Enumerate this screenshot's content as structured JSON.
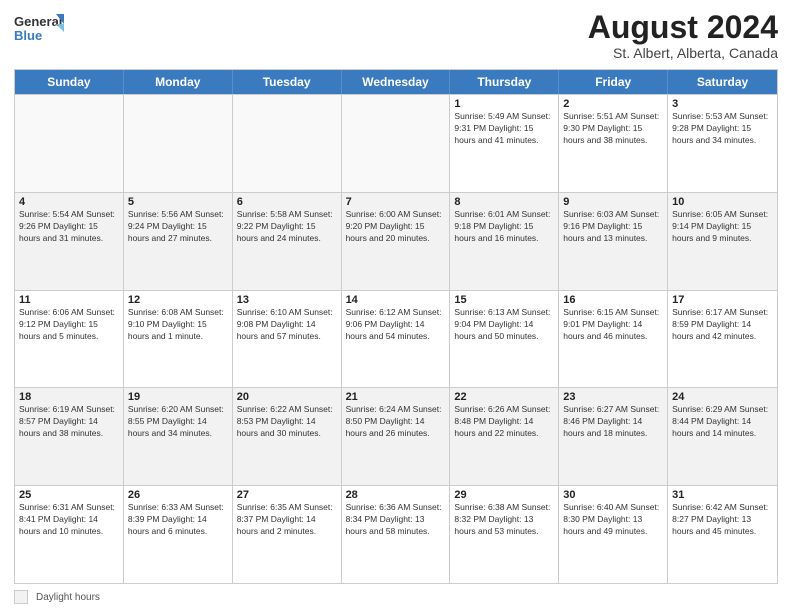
{
  "header": {
    "logo_line1": "General",
    "logo_line2": "Blue",
    "month_title": "August 2024",
    "subtitle": "St. Albert, Alberta, Canada"
  },
  "calendar": {
    "days_of_week": [
      "Sunday",
      "Monday",
      "Tuesday",
      "Wednesday",
      "Thursday",
      "Friday",
      "Saturday"
    ],
    "rows": [
      [
        {
          "day": "",
          "info": "",
          "empty": true
        },
        {
          "day": "",
          "info": "",
          "empty": true
        },
        {
          "day": "",
          "info": "",
          "empty": true
        },
        {
          "day": "",
          "info": "",
          "empty": true
        },
        {
          "day": "1",
          "info": "Sunrise: 5:49 AM\nSunset: 9:31 PM\nDaylight: 15 hours\nand 41 minutes."
        },
        {
          "day": "2",
          "info": "Sunrise: 5:51 AM\nSunset: 9:30 PM\nDaylight: 15 hours\nand 38 minutes."
        },
        {
          "day": "3",
          "info": "Sunrise: 5:53 AM\nSunset: 9:28 PM\nDaylight: 15 hours\nand 34 minutes."
        }
      ],
      [
        {
          "day": "4",
          "info": "Sunrise: 5:54 AM\nSunset: 9:26 PM\nDaylight: 15 hours\nand 31 minutes."
        },
        {
          "day": "5",
          "info": "Sunrise: 5:56 AM\nSunset: 9:24 PM\nDaylight: 15 hours\nand 27 minutes."
        },
        {
          "day": "6",
          "info": "Sunrise: 5:58 AM\nSunset: 9:22 PM\nDaylight: 15 hours\nand 24 minutes."
        },
        {
          "day": "7",
          "info": "Sunrise: 6:00 AM\nSunset: 9:20 PM\nDaylight: 15 hours\nand 20 minutes."
        },
        {
          "day": "8",
          "info": "Sunrise: 6:01 AM\nSunset: 9:18 PM\nDaylight: 15 hours\nand 16 minutes."
        },
        {
          "day": "9",
          "info": "Sunrise: 6:03 AM\nSunset: 9:16 PM\nDaylight: 15 hours\nand 13 minutes."
        },
        {
          "day": "10",
          "info": "Sunrise: 6:05 AM\nSunset: 9:14 PM\nDaylight: 15 hours\nand 9 minutes."
        }
      ],
      [
        {
          "day": "11",
          "info": "Sunrise: 6:06 AM\nSunset: 9:12 PM\nDaylight: 15 hours\nand 5 minutes."
        },
        {
          "day": "12",
          "info": "Sunrise: 6:08 AM\nSunset: 9:10 PM\nDaylight: 15 hours\nand 1 minute."
        },
        {
          "day": "13",
          "info": "Sunrise: 6:10 AM\nSunset: 9:08 PM\nDaylight: 14 hours\nand 57 minutes."
        },
        {
          "day": "14",
          "info": "Sunrise: 6:12 AM\nSunset: 9:06 PM\nDaylight: 14 hours\nand 54 minutes."
        },
        {
          "day": "15",
          "info": "Sunrise: 6:13 AM\nSunset: 9:04 PM\nDaylight: 14 hours\nand 50 minutes."
        },
        {
          "day": "16",
          "info": "Sunrise: 6:15 AM\nSunset: 9:01 PM\nDaylight: 14 hours\nand 46 minutes."
        },
        {
          "day": "17",
          "info": "Sunrise: 6:17 AM\nSunset: 8:59 PM\nDaylight: 14 hours\nand 42 minutes."
        }
      ],
      [
        {
          "day": "18",
          "info": "Sunrise: 6:19 AM\nSunset: 8:57 PM\nDaylight: 14 hours\nand 38 minutes."
        },
        {
          "day": "19",
          "info": "Sunrise: 6:20 AM\nSunset: 8:55 PM\nDaylight: 14 hours\nand 34 minutes."
        },
        {
          "day": "20",
          "info": "Sunrise: 6:22 AM\nSunset: 8:53 PM\nDaylight: 14 hours\nand 30 minutes."
        },
        {
          "day": "21",
          "info": "Sunrise: 6:24 AM\nSunset: 8:50 PM\nDaylight: 14 hours\nand 26 minutes."
        },
        {
          "day": "22",
          "info": "Sunrise: 6:26 AM\nSunset: 8:48 PM\nDaylight: 14 hours\nand 22 minutes."
        },
        {
          "day": "23",
          "info": "Sunrise: 6:27 AM\nSunset: 8:46 PM\nDaylight: 14 hours\nand 18 minutes."
        },
        {
          "day": "24",
          "info": "Sunrise: 6:29 AM\nSunset: 8:44 PM\nDaylight: 14 hours\nand 14 minutes."
        }
      ],
      [
        {
          "day": "25",
          "info": "Sunrise: 6:31 AM\nSunset: 8:41 PM\nDaylight: 14 hours\nand 10 minutes."
        },
        {
          "day": "26",
          "info": "Sunrise: 6:33 AM\nSunset: 8:39 PM\nDaylight: 14 hours\nand 6 minutes."
        },
        {
          "day": "27",
          "info": "Sunrise: 6:35 AM\nSunset: 8:37 PM\nDaylight: 14 hours\nand 2 minutes."
        },
        {
          "day": "28",
          "info": "Sunrise: 6:36 AM\nSunset: 8:34 PM\nDaylight: 13 hours\nand 58 minutes."
        },
        {
          "day": "29",
          "info": "Sunrise: 6:38 AM\nSunset: 8:32 PM\nDaylight: 13 hours\nand 53 minutes."
        },
        {
          "day": "30",
          "info": "Sunrise: 6:40 AM\nSunset: 8:30 PM\nDaylight: 13 hours\nand 49 minutes."
        },
        {
          "day": "31",
          "info": "Sunrise: 6:42 AM\nSunset: 8:27 PM\nDaylight: 13 hours\nand 45 minutes."
        }
      ]
    ]
  },
  "footer": {
    "legend_label": "Daylight hours"
  }
}
